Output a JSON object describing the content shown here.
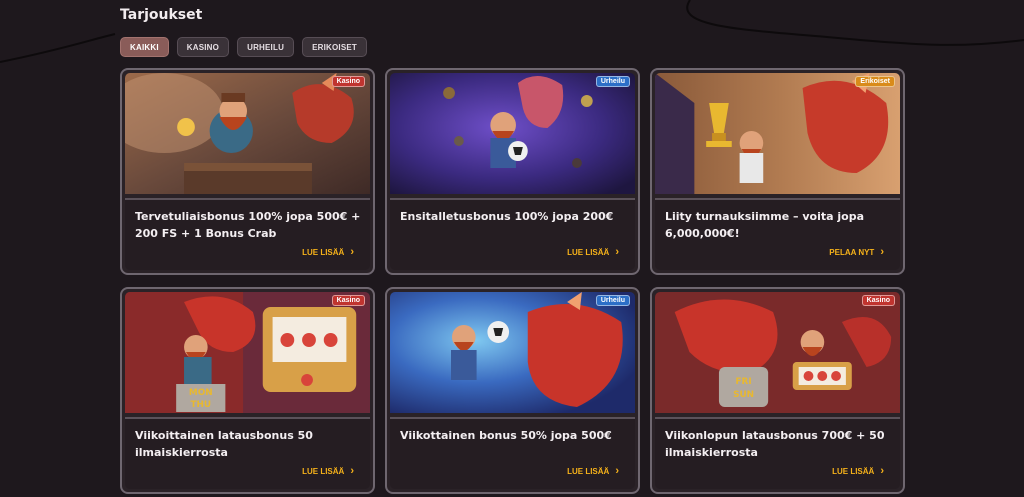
{
  "page": {
    "title": "Tarjoukset"
  },
  "filters": [
    {
      "label": "KAIKKI",
      "active": true
    },
    {
      "label": "KASINO",
      "active": false
    },
    {
      "label": "URHEILU",
      "active": false
    },
    {
      "label": "ERIKOISET",
      "active": false
    }
  ],
  "badge_colors": {
    "Kasino": "#c0342f",
    "Urheilu": "#2c6fc7",
    "Erikoiset": "#d98b1a"
  },
  "cards": [
    {
      "badge": "Kasino",
      "title": "Tervetuliaisbonus 100% jopa 500€ + 200 FS + 1 Bonus Crab",
      "cta": "LUE LISÄÄ",
      "theme": "mine"
    },
    {
      "badge": "Urheilu",
      "title": "Ensitalletusbonus 100% jopa 200€",
      "cta": "LUE LISÄÄ",
      "theme": "soccer"
    },
    {
      "badge": "Erikoiset",
      "title": "Liity turnauksiimme – voita jopa 6,000,000€!",
      "cta": "PELAA NYT",
      "theme": "trophy"
    },
    {
      "badge": "Kasino",
      "title": "Viikoittainen latausbonus 50 ilmaiskierrosta",
      "cta": "LUE LISÄÄ",
      "theme": "slot-mon"
    },
    {
      "badge": "Urheilu",
      "title": "Viikottainen bonus 50% jopa 500€",
      "cta": "LUE LISÄÄ",
      "theme": "soccer2"
    },
    {
      "badge": "Kasino",
      "title": "Viikonlopun latausbonus 700€ + 50 ilmaiskierrosta",
      "cta": "LUE LISÄÄ",
      "theme": "slot-fri"
    }
  ],
  "art_labels": {
    "mon": "MON",
    "thu": "THU",
    "fri": "FRI",
    "sun": "SUN"
  }
}
